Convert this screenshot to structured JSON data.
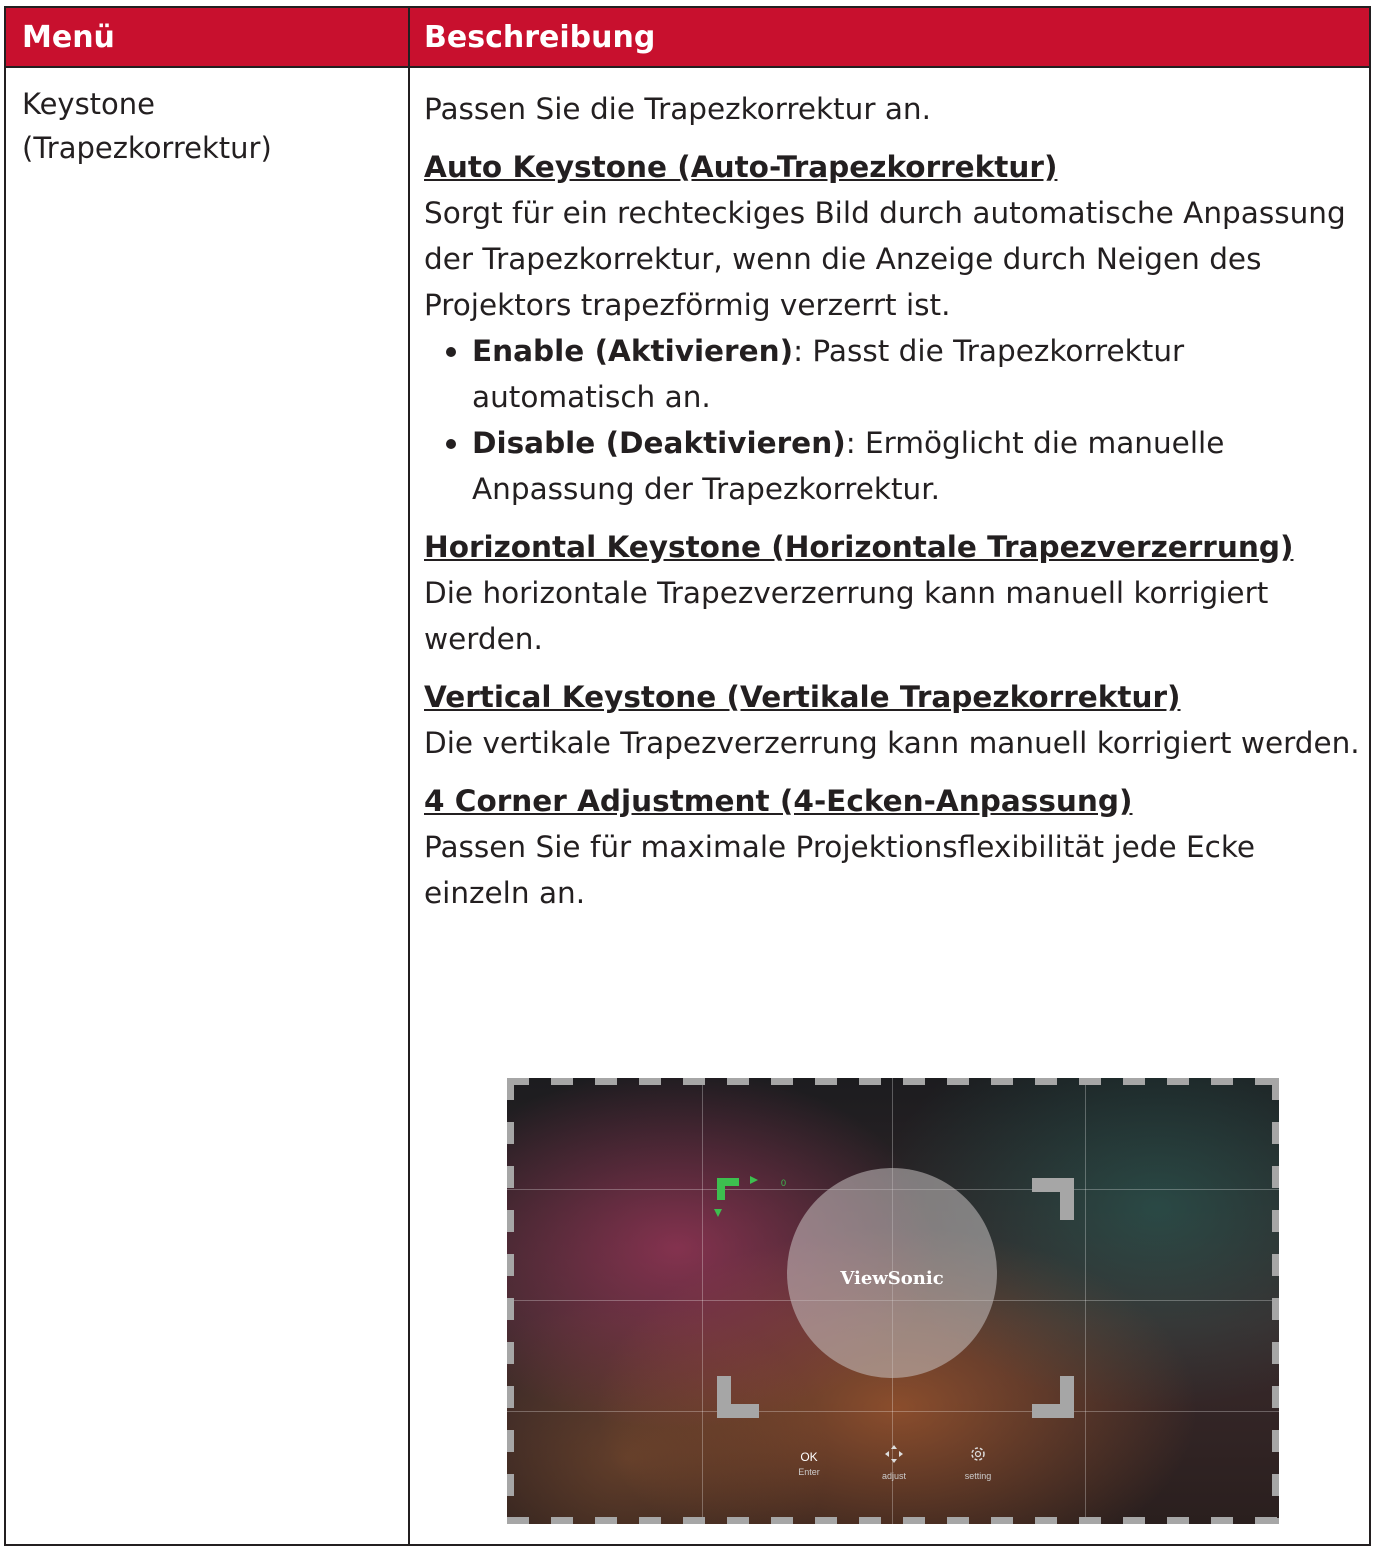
{
  "table": {
    "header": {
      "menu": "Menü",
      "description": "Beschreibung"
    },
    "row": {
      "menu": "Keystone (Trapezkorrektur)",
      "intro": "Passen Sie die Trapezkorrektur an.",
      "auto": {
        "heading": "Auto Keystone (Auto-Trapezkorrektur)",
        "text": "Sorgt für ein rechteckiges Bild durch automatische Anpassung der Trapezkorrektur, wenn die Anzeige durch Neigen des Projektors trapezförmig verzerrt ist.",
        "options": [
          {
            "label": "Enable (Aktivieren)",
            "text": ": Passt die Trapezkorrektur automatisch an."
          },
          {
            "label": "Disable (Deaktivieren)",
            "text": ": Ermöglicht die manuelle Anpassung der Trapezkorrektur."
          }
        ]
      },
      "horizontal": {
        "heading": "Horizontal Keystone (Horizontale Trapezverzerrung)",
        "text": "Die horizontale Trapezverzerrung kann manuell korrigiert werden."
      },
      "vertical": {
        "heading": "Vertical Keystone (Vertikale Trapezkorrektur)",
        "text": "Die vertikale Trapezverzerrung kann manuell korrigiert werden."
      },
      "corner": {
        "heading": "4 Corner Adjustment (4-Ecken-Anpassung)",
        "text": "Passen Sie für maximale Projektionsflexibilität jede Ecke einzeln an."
      }
    }
  },
  "figure": {
    "brand": "ViewSonic",
    "counter": "0",
    "controls": [
      {
        "top": "OK",
        "bottom": "Enter",
        "icon": "ok-text"
      },
      {
        "top": "",
        "bottom": "adjust",
        "icon": "dpad-icon"
      },
      {
        "top": "",
        "bottom": "setting",
        "icon": "gear-icon"
      }
    ]
  },
  "colors": {
    "header_bg": "#c8102e",
    "active_corner": "#3dbf4f",
    "inactive_corner": "#a6a6a6"
  }
}
